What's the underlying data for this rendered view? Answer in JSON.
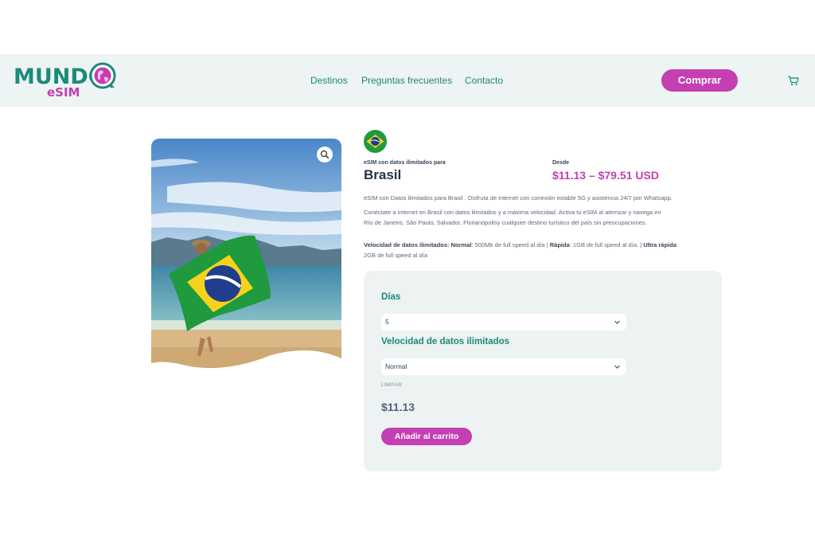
{
  "header": {
    "logo": {
      "word": "MUNDO",
      "sub": "eSIM"
    },
    "nav": [
      {
        "label": "Destinos"
      },
      {
        "label": "Preguntas frecuentes"
      },
      {
        "label": "Contacto"
      }
    ],
    "buy_label": "Comprar",
    "cart_icon": "cart-icon"
  },
  "product": {
    "image_icon": "zoom-icon",
    "flag": "brazil-flag",
    "subtitle": "eSIM con datos ilimitados para",
    "title": "Brasil",
    "desde_label": "Desde",
    "price_range": "$11.13 – $79.51 USD",
    "desc1": "eSIM con Datos ilimitados para Brasil . Disfruta de internet con conexión estable 5G y asistencia 24/7 por Whatsapp.",
    "desc2_line1": "Conéctate a internet en Brasil con datos ilimitados y a máxima velocidad. Activa tu eSIM al aterrizar y navega en",
    "desc2_line2": "Río de Janeiro, São Paulo, Salvador, Florianópolisy cualquier destino turístico del país sin preocupaciones.",
    "speed": {
      "label": "Velocidad de datos ilimitados:",
      "normal_label": "Normal",
      "normal_text": ": 500Mb de full speed al día |",
      "rapida_label": "Rápida",
      "rapida_text": ": 1GB de full speed al día. |",
      "ultra_label": "Ultra rápida",
      "ultra_text": ":",
      "line2": "2GB de full speed al día"
    }
  },
  "options": {
    "days_label": "Días",
    "days_value": "5",
    "speed_label": "Velocidad de datos ilimitados",
    "speed_value": "Normal",
    "clear_label": "LIMPIAR",
    "price": "$11.13",
    "add_label": "Añadir al carrito"
  },
  "colors": {
    "brand_green": "#1b8a7a",
    "brand_magenta": "#c33fb2",
    "header_bg": "#edf4f3"
  }
}
